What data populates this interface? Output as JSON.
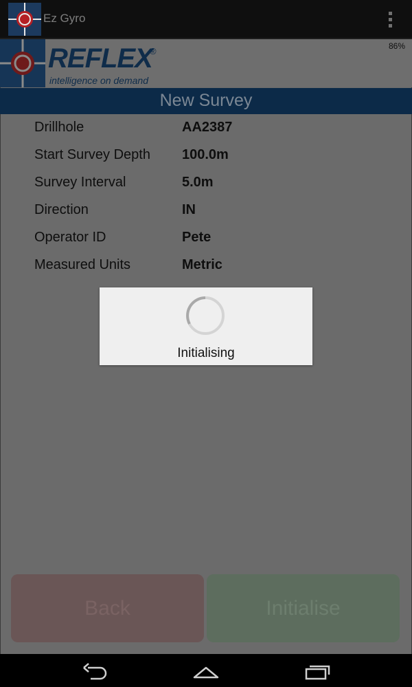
{
  "app_bar": {
    "title": "Ez Gyro",
    "icon": "target-crosshair-icon",
    "overflow_icon": "overflow-menu-icon"
  },
  "header": {
    "logo_text": "REFLEX",
    "logo_reg": "®",
    "tagline": "intelligence on demand",
    "battery": "86%",
    "brand_color": "#163556"
  },
  "screen": {
    "title": "New Survey"
  },
  "fields": [
    {
      "label": "Drillhole",
      "value": "AA2387"
    },
    {
      "label": "Start Survey Depth",
      "value": "100.0m"
    },
    {
      "label": "Survey Interval",
      "value": "5.0m"
    },
    {
      "label": "Direction",
      "value": "IN"
    },
    {
      "label": "Operator ID",
      "value": "Pete"
    },
    {
      "label": "Measured Units",
      "value": "Metric"
    }
  ],
  "dialog": {
    "text": "Initialising",
    "icon": "progress-spinner-icon"
  },
  "buttons": {
    "back": "Back",
    "initialise": "Initialise"
  },
  "navbar": {
    "back_icon": "back-icon",
    "home_icon": "home-icon",
    "recents_icon": "recents-icon"
  }
}
